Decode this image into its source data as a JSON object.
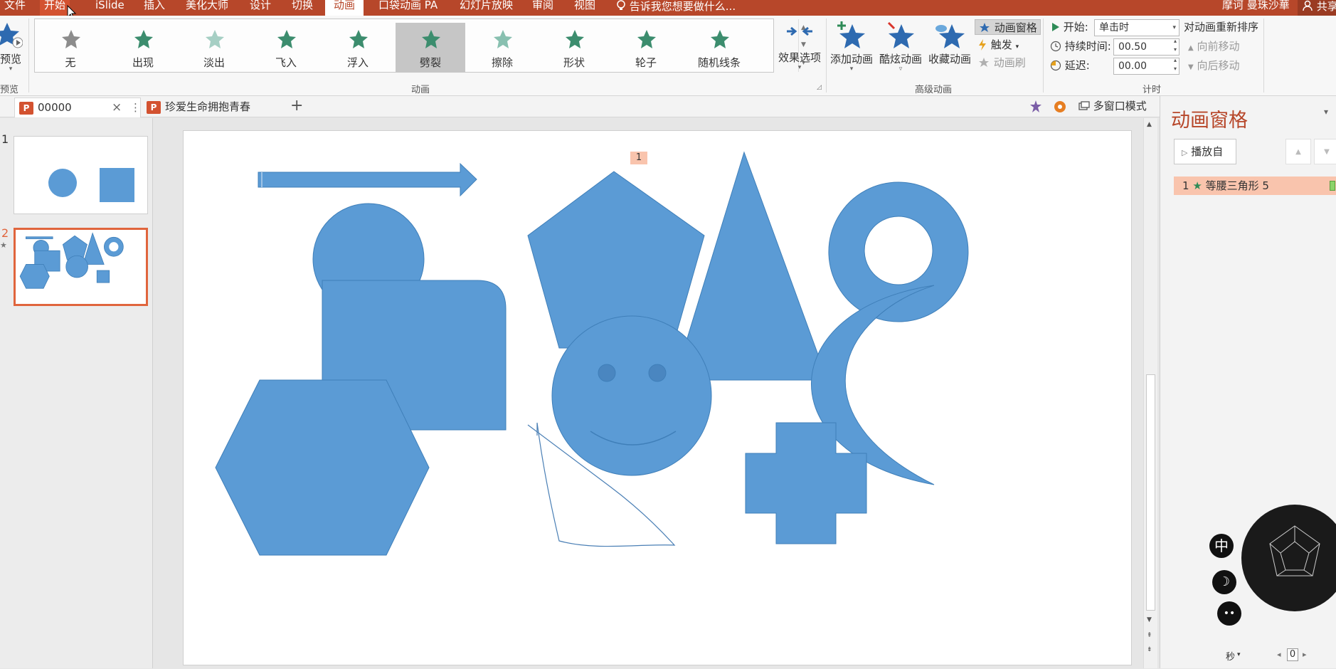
{
  "menu": {
    "items": [
      "文件",
      "开始",
      "iSlide",
      "插入",
      "美化大师",
      "设计",
      "切换",
      "动画",
      "口袋动画 PA",
      "幻灯片放映",
      "审阅",
      "视图"
    ],
    "tell_me": "告诉我您想要做什么...",
    "user": "摩诃 曼珠沙華",
    "share": "共享"
  },
  "ribbon": {
    "preview": {
      "label": "预览",
      "group": "预览"
    },
    "gallery": [
      {
        "label": "无",
        "color": "#8c8c8c"
      },
      {
        "label": "出现",
        "color": "#3c8d6e"
      },
      {
        "label": "淡出",
        "color": "#a6cfc4"
      },
      {
        "label": "飞入",
        "color": "#3c8d6e"
      },
      {
        "label": "浮入",
        "color": "#3c8d6e"
      },
      {
        "label": "劈裂",
        "color": "#3c8d6e"
      },
      {
        "label": "擦除",
        "color": "#88c0b0"
      },
      {
        "label": "形状",
        "color": "#3c8d6e"
      },
      {
        "label": "轮子",
        "color": "#3c8d6e"
      },
      {
        "label": "随机线条",
        "color": "#3c8d6e"
      }
    ],
    "effect_options": "效果选项",
    "group_animation": "动画",
    "add_animation": "添加动画",
    "cool_animation": "酷炫动画",
    "collect_animation": "收藏动画",
    "animation_pane": "动画窗格",
    "trigger": "触发",
    "animation_painter": "动画刷",
    "group_advanced": "高级动画",
    "start_label": "开始:",
    "start_value": "单击时",
    "duration_label": "持续时间:",
    "duration_value": "00.50",
    "delay_label": "延迟:",
    "delay_value": "00.00",
    "reorder_title": "对动画重新排序",
    "move_earlier": "向前移动",
    "move_later": "向后移动",
    "group_timing": "计时"
  },
  "tabs": {
    "doc1": "00000",
    "doc2": "珍爱生命拥抱青春",
    "multiwindow": "多窗口模式"
  },
  "thumbs": {
    "n1": "1",
    "n2": "2"
  },
  "slide": {
    "anim_marker": "1"
  },
  "pane": {
    "title": "动画窗格",
    "play_from": "播放自",
    "item_index": "1",
    "item_name": "等腰三角形 5",
    "seconds": "秒",
    "page_value": "0",
    "badge_zhong": "中"
  },
  "colors": {
    "accent": "#b7472a",
    "shape": "#5b9bd5"
  }
}
